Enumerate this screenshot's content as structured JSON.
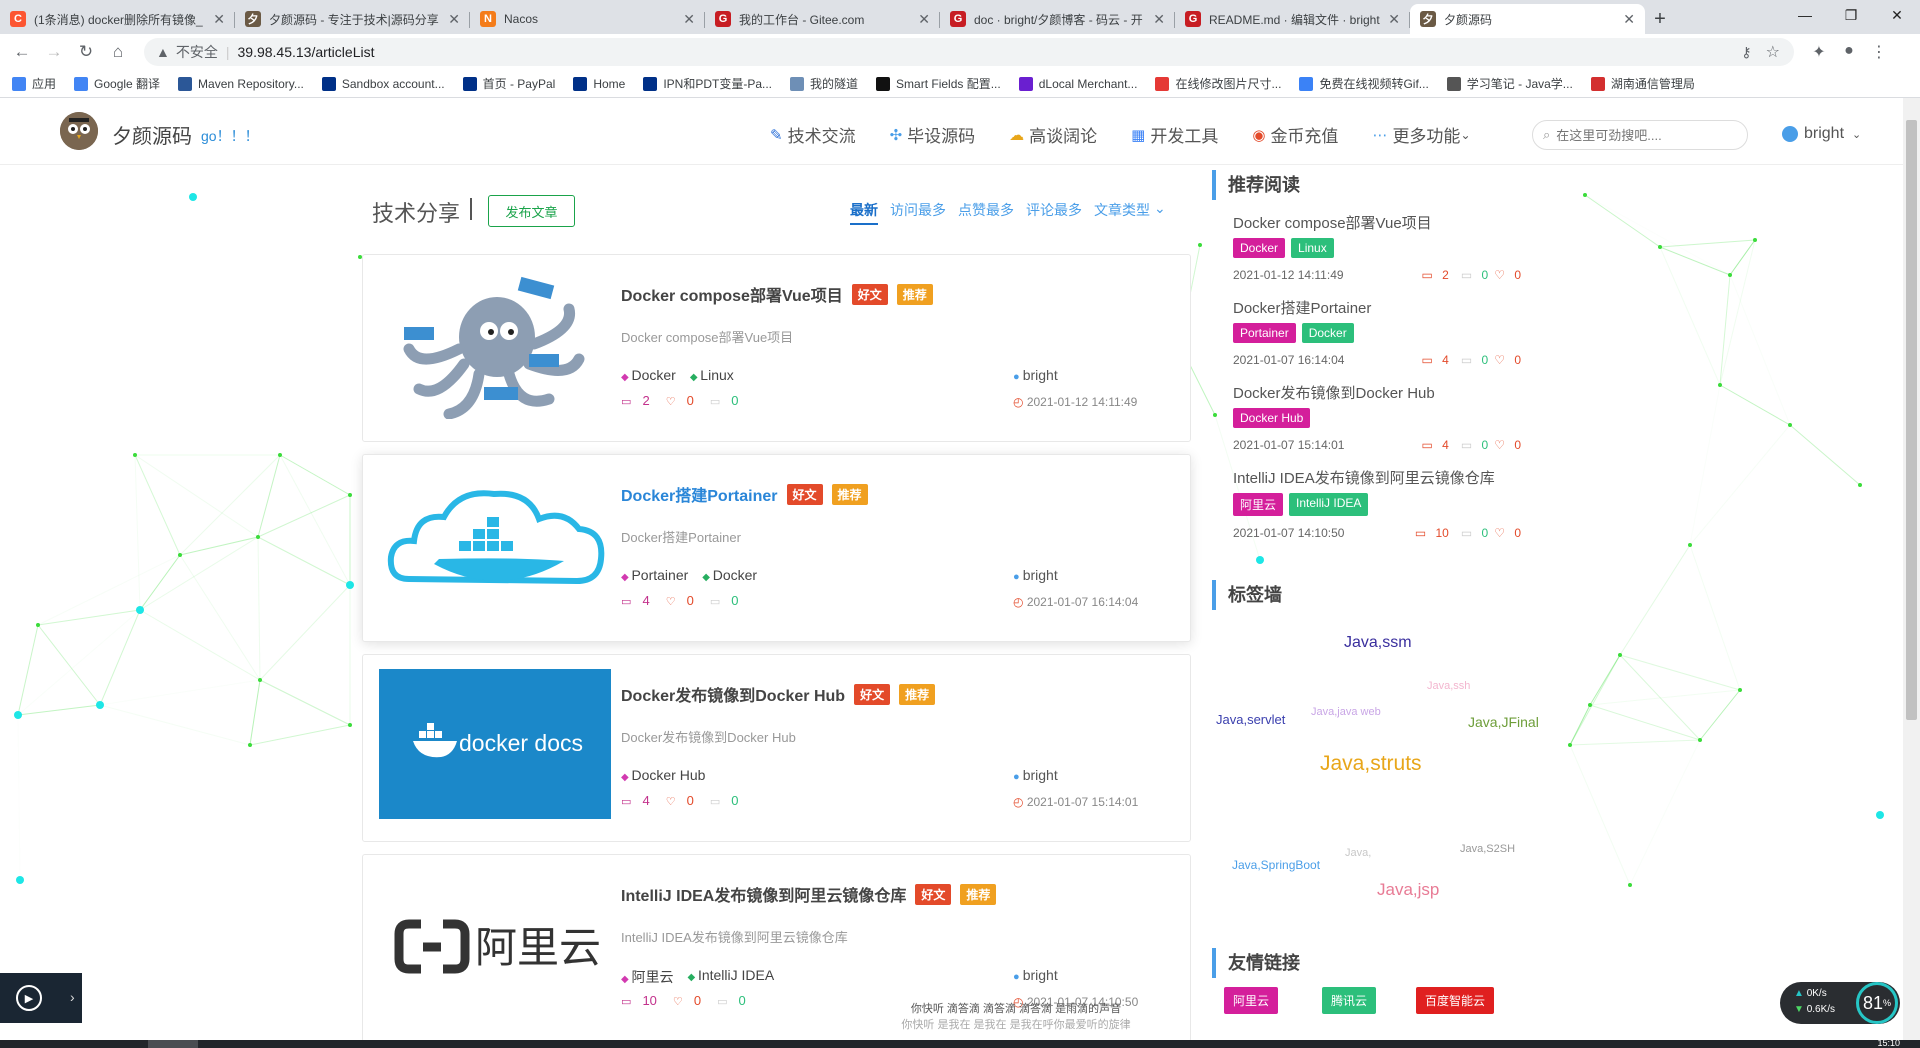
{
  "browser": {
    "tabs": [
      {
        "title": "(1条消息) docker删除所有镜像_",
        "icon": "csdn",
        "color": "#fc5531",
        "glyph": "C"
      },
      {
        "title": "夕颜源码 - 专注于技术|源码分享",
        "icon": "owl",
        "color": "#6b5a45",
        "glyph": "夕"
      },
      {
        "title": "Nacos",
        "icon": "nacos",
        "color": "#f47c1a",
        "glyph": "N"
      },
      {
        "title": "我的工作台 - Gitee.com",
        "icon": "gitee",
        "color": "#c71d23",
        "glyph": "G"
      },
      {
        "title": "doc · bright/夕颜博客 - 码云 - 开",
        "icon": "gitee",
        "color": "#c71d23",
        "glyph": "G"
      },
      {
        "title": "README.md · 编辑文件 · bright",
        "icon": "gitee",
        "color": "#c71d23",
        "glyph": "G"
      },
      {
        "title": "夕颜源码",
        "icon": "owl",
        "color": "#6b5a45",
        "glyph": "夕"
      }
    ],
    "security_label": "不安全",
    "url": "39.98.45.13/articleList",
    "bookmarks": [
      {
        "label": "应用",
        "color": "#4285f4"
      },
      {
        "label": "Google 翻译",
        "color": "#4285f4"
      },
      {
        "label": "Maven Repository...",
        "color": "#2b5797"
      },
      {
        "label": "Sandbox account...",
        "color": "#003087"
      },
      {
        "label": "首页 - PayPal",
        "color": "#003087"
      },
      {
        "label": "Home",
        "color": "#003087"
      },
      {
        "label": "IPN和PDT变量-Pa...",
        "color": "#003087"
      },
      {
        "label": "我的隧道",
        "color": "#6e8fb6"
      },
      {
        "label": "Smart Fields 配置...",
        "color": "#111111"
      },
      {
        "label": "dLocal Merchant...",
        "color": "#6a1fd0"
      },
      {
        "label": "在线修改图片尺寸...",
        "color": "#e53935"
      },
      {
        "label": "免费在线视频转Gif...",
        "color": "#3b82f6"
      },
      {
        "label": "学习笔记 - Java学...",
        "color": "#555555"
      },
      {
        "label": "湖南通信管理局",
        "color": "#d32f2f"
      }
    ]
  },
  "site": {
    "brand": "夕颜源码",
    "brand_sub": "go！！！",
    "nav": [
      {
        "label": "技术交流",
        "icon": "feather-icon"
      },
      {
        "label": "毕设源码",
        "icon": "share-icon"
      },
      {
        "label": "高谈阔论",
        "icon": "cloud-icon"
      },
      {
        "label": "开发工具",
        "icon": "calendar-icon"
      },
      {
        "label": "金币充值",
        "icon": "coin-icon"
      },
      {
        "label": "更多功能",
        "icon": "more-icon"
      }
    ],
    "search_placeholder": "在这里可劲搜吧....",
    "username": "bright"
  },
  "list": {
    "title": "技术分享",
    "publish_button": "发布文章",
    "sorts": [
      "最新",
      "访问最多",
      "点赞最多",
      "评论最多",
      "文章类型"
    ]
  },
  "articles": [
    {
      "title": "Docker compose部署Vue项目",
      "badges": [
        "好文",
        "推荐"
      ],
      "desc": "Docker compose部署Vue项目",
      "tags": [
        "Docker",
        "Linux"
      ],
      "views": "2",
      "likes": "0",
      "comments": "0",
      "author": "bright",
      "date": "2021-01-12 14:11:49"
    },
    {
      "title": "Docker搭建Portainer",
      "badges": [
        "好文",
        "推荐"
      ],
      "desc": "Docker搭建Portainer",
      "tags": [
        "Portainer",
        "Docker"
      ],
      "views": "4",
      "likes": "0",
      "comments": "0",
      "author": "bright",
      "date": "2021-01-07 16:14:04"
    },
    {
      "title": "Docker发布镜像到Docker Hub",
      "badges": [
        "好文",
        "推荐"
      ],
      "desc": "Docker发布镜像到Docker Hub",
      "tags": [
        "Docker Hub"
      ],
      "views": "4",
      "likes": "0",
      "comments": "0",
      "author": "bright",
      "date": "2021-01-07 15:14:01"
    },
    {
      "title": "IntelliJ IDEA发布镜像到阿里云镜像仓库",
      "badges": [
        "好文",
        "推荐"
      ],
      "desc": "IntelliJ IDEA发布镜像到阿里云镜像仓库",
      "tags": [
        "阿里云",
        "IntelliJ IDEA"
      ],
      "views": "10",
      "likes": "0",
      "comments": "0",
      "author": "bright",
      "date": "2021-01-07 14:10:50"
    }
  ],
  "thumbs": {
    "docker_docs": "docker docs",
    "aliyun_logo": "阿里云"
  },
  "sidebar": {
    "recommend_title": "推荐阅读",
    "recommend": [
      {
        "title": "Docker compose部署Vue项目",
        "tags": [
          "Docker",
          "Linux"
        ],
        "date": "2021-01-12 14:11:49",
        "views": "2",
        "comments": "0",
        "likes": "0"
      },
      {
        "title": "Docker搭建Portainer",
        "tags": [
          "Portainer",
          "Docker"
        ],
        "date": "2021-01-07 16:14:04",
        "views": "4",
        "comments": "0",
        "likes": "0"
      },
      {
        "title": "Docker发布镜像到Docker Hub",
        "tags": [
          "Docker Hub"
        ],
        "date": "2021-01-07 15:14:01",
        "views": "4",
        "comments": "0",
        "likes": "0"
      },
      {
        "title": "IntelliJ IDEA发布镜像到阿里云镜像仓库",
        "tags": [
          "阿里云",
          "IntelliJ IDEA"
        ],
        "date": "2021-01-07 14:10:50",
        "views": "10",
        "comments": "0",
        "likes": "0"
      }
    ],
    "tagwall_title": "标签墙",
    "tagwall": [
      {
        "label": "Java,ssm",
        "color": "#3a2f9e"
      },
      {
        "label": "Java,ssh",
        "color": "#f3b6cf"
      },
      {
        "label": "Java,servlet",
        "color": "#3a3fae"
      },
      {
        "label": "Java,java web",
        "color": "#c9a6e6"
      },
      {
        "label": "Java,JFinal",
        "color": "#6e9e3a"
      },
      {
        "label": "Java,struts",
        "color": "#e8a61a"
      },
      {
        "label": "Java,",
        "color": "#c8c8c8"
      },
      {
        "label": "Java,S2SH",
        "color": "#999999"
      },
      {
        "label": "Java,SpringBoot",
        "color": "#4a9ee8"
      },
      {
        "label": "Java,jsp",
        "color": "#e87b95"
      }
    ],
    "links_title": "友情链接",
    "links": [
      {
        "label": "阿里云",
        "color": "#d41f9b"
      },
      {
        "label": "腾讯云",
        "color": "#2cbf7b"
      },
      {
        "label": "百度智能云",
        "color": "#e02020"
      }
    ]
  },
  "player": {
    "lyric_1": "你快听 滴答滴 滴答滴 滴答滴 是雨滴的声音",
    "lyric_2": "你快听 是我在 是我在 是我在呼你最爱听的旋律"
  },
  "netmon": {
    "up": "0K/s",
    "down": "0.6K/s",
    "percent": "81"
  },
  "clock": "15:10"
}
